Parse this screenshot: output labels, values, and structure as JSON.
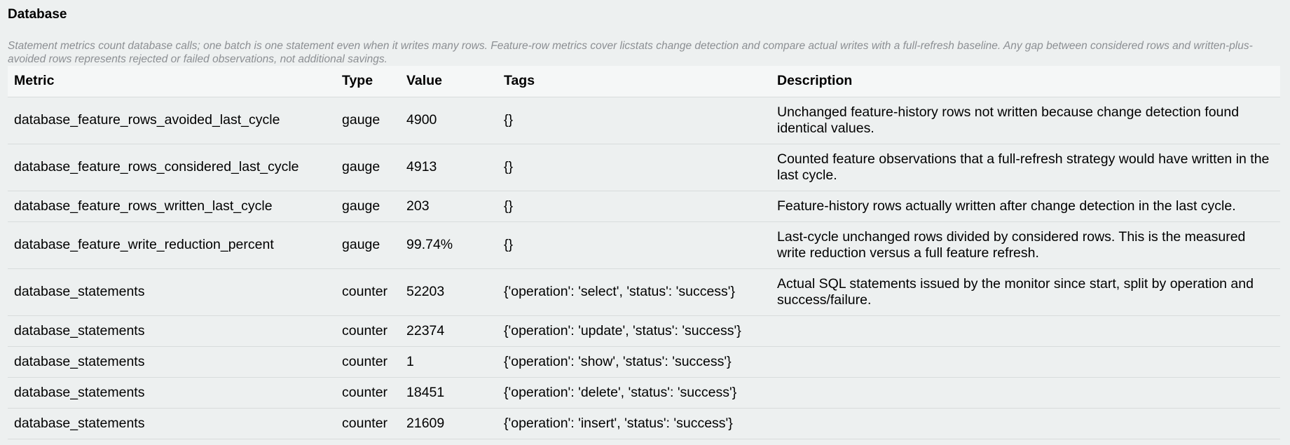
{
  "section": {
    "title": "Database",
    "note": "Statement metrics count database calls; one batch is one statement even when it writes many rows. Feature-row metrics cover licstats change detection and compare actual writes with a full-refresh baseline. Any gap between considered rows and written-plus-avoided rows represents rejected or failed observations, not additional savings."
  },
  "table": {
    "headers": {
      "metric": "Metric",
      "type": "Type",
      "value": "Value",
      "tags": "Tags",
      "description": "Description"
    },
    "rows": [
      {
        "metric": "database_feature_rows_avoided_last_cycle",
        "type": "gauge",
        "value": "4900",
        "tags": "{}",
        "description": "Unchanged feature-history rows not written because change detection found identical values."
      },
      {
        "metric": "database_feature_rows_considered_last_cycle",
        "type": "gauge",
        "value": "4913",
        "tags": "{}",
        "description": "Counted feature observations that a full-refresh strategy would have written in the last cycle."
      },
      {
        "metric": "database_feature_rows_written_last_cycle",
        "type": "gauge",
        "value": "203",
        "tags": "{}",
        "description": "Feature-history rows actually written after change detection in the last cycle."
      },
      {
        "metric": "database_feature_write_reduction_percent",
        "type": "gauge",
        "value": "99.74%",
        "tags": "{}",
        "description": "Last-cycle unchanged rows divided by considered rows. This is the measured write reduction versus a full feature refresh."
      },
      {
        "metric": "database_statements",
        "type": "counter",
        "value": "52203",
        "tags": "{'operation': 'select', 'status': 'success'}",
        "description": "Actual SQL statements issued by the monitor since start, split by operation and success/failure."
      },
      {
        "metric": "database_statements",
        "type": "counter",
        "value": "22374",
        "tags": "{'operation': 'update', 'status': 'success'}",
        "description": ""
      },
      {
        "metric": "database_statements",
        "type": "counter",
        "value": "1",
        "tags": "{'operation': 'show', 'status': 'success'}",
        "description": ""
      },
      {
        "metric": "database_statements",
        "type": "counter",
        "value": "18451",
        "tags": "{'operation': 'delete', 'status': 'success'}",
        "description": ""
      },
      {
        "metric": "database_statements",
        "type": "counter",
        "value": "21609",
        "tags": "{'operation': 'insert', 'status': 'success'}",
        "description": ""
      }
    ]
  }
}
